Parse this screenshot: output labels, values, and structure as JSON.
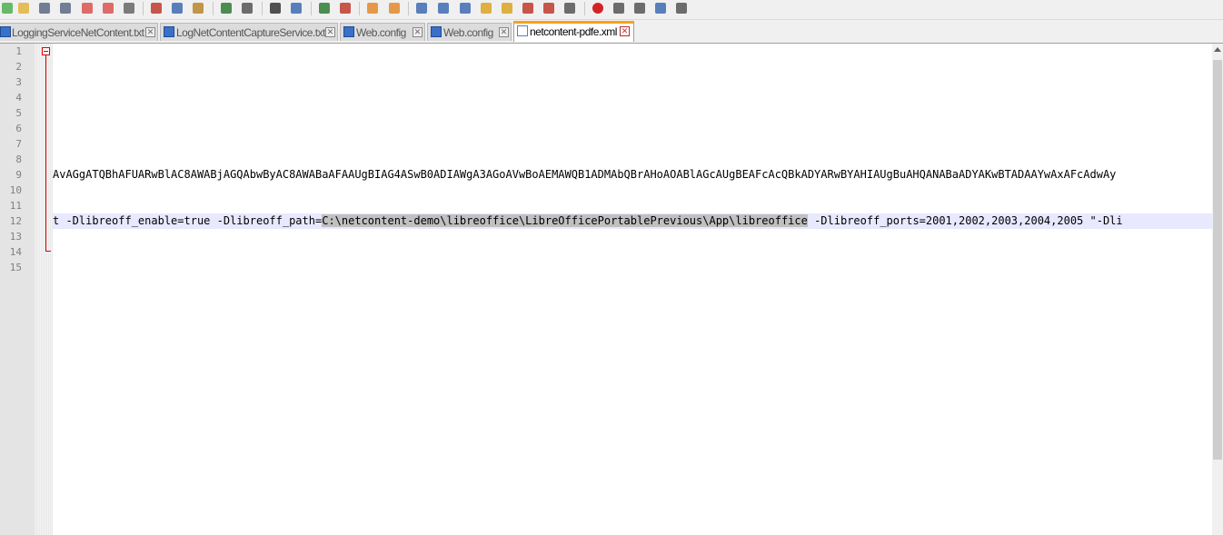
{
  "toolbar": {
    "buttons": [
      {
        "icon": "new-file-icon",
        "color": "#4caf50"
      },
      {
        "icon": "open-file-icon",
        "color": "#e2b43c"
      },
      {
        "icon": "save-icon",
        "color": "#5a6a82"
      },
      {
        "icon": "save-all-icon",
        "color": "#5a6a82"
      },
      {
        "icon": "close-icon",
        "color": "#d9534f"
      },
      {
        "icon": "close-all-icon",
        "color": "#d9534f"
      },
      {
        "icon": "print-icon",
        "color": "#666666"
      },
      {
        "icon": "cut-icon",
        "color": "#c0392b"
      },
      {
        "icon": "copy-icon",
        "color": "#3d6bb3"
      },
      {
        "icon": "paste-icon",
        "color": "#b8862b"
      },
      {
        "icon": "undo-icon",
        "color": "#2e7d32"
      },
      {
        "icon": "redo-icon",
        "color": "#555555"
      },
      {
        "icon": "find-icon",
        "color": "#333333"
      },
      {
        "icon": "replace-icon",
        "color": "#3d6bb3"
      },
      {
        "icon": "zoom-in-icon",
        "color": "#2e7d32"
      },
      {
        "icon": "zoom-out-icon",
        "color": "#c0392b"
      },
      {
        "icon": "sync-vertical-icon",
        "color": "#e28a2b"
      },
      {
        "icon": "sync-horizontal-icon",
        "color": "#e28a2b"
      },
      {
        "icon": "word-wrap-icon",
        "color": "#3d6bb3"
      },
      {
        "icon": "show-all-characters-icon",
        "color": "#3d6bb3"
      },
      {
        "icon": "indent-guide-icon",
        "color": "#3d6bb3"
      },
      {
        "icon": "user-language-icon",
        "color": "#d9a521"
      },
      {
        "icon": "document-map-icon",
        "color": "#d9a521"
      },
      {
        "icon": "function-list-icon",
        "color": "#c0392b"
      },
      {
        "icon": "folder-as-workspace-icon",
        "color": "#c0392b"
      },
      {
        "icon": "monitoring-icon",
        "color": "#555555"
      },
      {
        "icon": "record-macro-icon",
        "color": "#cc0000"
      },
      {
        "icon": "stop-recording-icon",
        "color": "#555555"
      },
      {
        "icon": "playback-macro-icon",
        "color": "#555555"
      },
      {
        "icon": "run-macro-multiple-icon",
        "color": "#3d6bb3"
      },
      {
        "icon": "save-macro-icon",
        "color": "#555555"
      }
    ]
  },
  "tabs": [
    {
      "label": "LoggingServiceNetContent.txt",
      "active": false
    },
    {
      "label": "LogNetContentCaptureService.txt",
      "active": false
    },
    {
      "label": "Web.config",
      "active": false
    },
    {
      "label": "Web.config",
      "active": false
    },
    {
      "label": "netcontent-pdfe.xml",
      "active": true
    }
  ],
  "editor": {
    "line_numbers": [
      "1",
      "2",
      "3",
      "4",
      "5",
      "6",
      "7",
      "8",
      "9",
      "10",
      "11",
      "12",
      "13",
      "14",
      "15"
    ],
    "current_line": 12,
    "lines": [
      {
        "n": "9",
        "text": "AvAGgATQBhAFUARwBlAC8AWABjAGQAbwByAC8AWABaAFAAUgBIAG4ASwB0ADIAWgA3AGoAVwBoAEMAWQB1ADMAbQBrAHoAOABlAGcAUgBEAFcAcQBkADYARwBYAHIAUgBuAHQANABaADYAKwBTADAAYwAxAFcAdwAy"
      },
      {
        "n": "12",
        "before": "t -Dlibreoff_enable=true -Dlibreoff_path=",
        "selected": "C:\\netcontent-demo\\libreoffice\\LibreOfficePortablePrevious\\App\\libreoffice",
        "after": " -Dlibreoff_ports=2001,2002,2003,2004,2005 \"-Dli"
      }
    ]
  },
  "colors": {
    "fold_marker": "#dd0000",
    "current_line": "#e8e8ff",
    "selection": "#c0c0c0",
    "active_tab_accent": "#f7a21b"
  }
}
